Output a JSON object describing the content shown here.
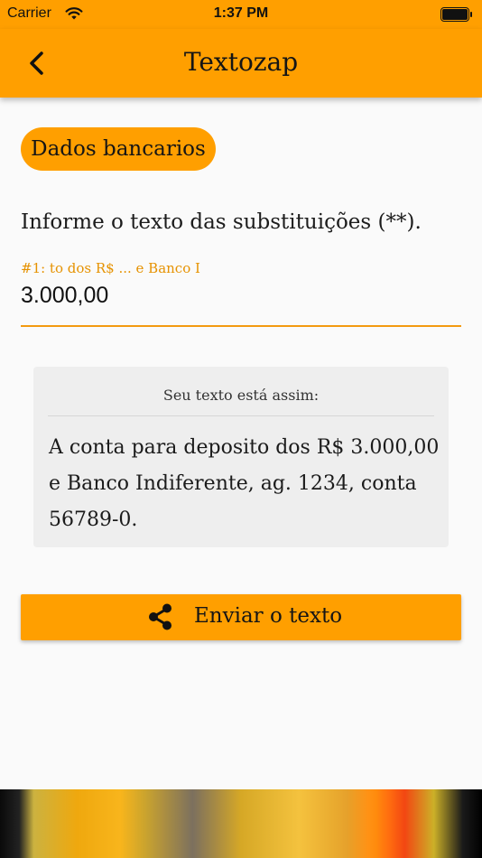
{
  "status_bar": {
    "carrier": "Carrier",
    "time": "1:37 PM",
    "wifi_icon": "wifi-icon",
    "battery_icon": "battery-icon"
  },
  "app_bar": {
    "title": "Textozap",
    "back_icon": "back-chevron-icon"
  },
  "chip": {
    "label": "Dados bancarios"
  },
  "instruction": "Informe o texto das substituições (**).",
  "field": {
    "label": "#1: to dos R$ ... e Banco I",
    "value": "3.000,00"
  },
  "preview": {
    "title": "Seu texto está assim:",
    "body": "A conta para deposito dos R$ 3.000,00 e Banco Indiferente, ag. 1234, conta 56789-0."
  },
  "send_button": {
    "label": "Enviar o texto",
    "icon": "share-icon"
  },
  "colors": {
    "accent": "#ff9f00",
    "field_label": "#e69200",
    "background": "#fafafa",
    "preview_bg": "#eeeeee"
  }
}
